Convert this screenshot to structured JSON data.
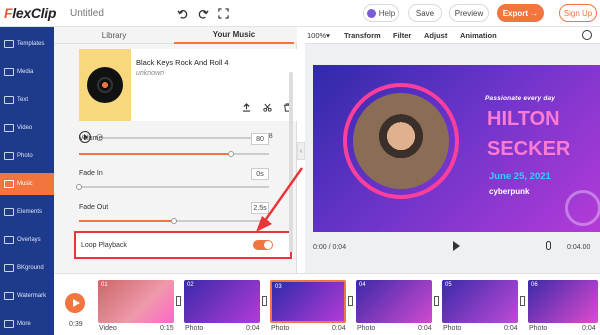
{
  "app": {
    "brand_first": "F",
    "brand_rest": "lexClip",
    "title_placeholder": "Untitled"
  },
  "topbar": {
    "help_label": "Help",
    "save_label": "Save",
    "preview_label": "Preview",
    "export_label": "Export →",
    "signup_label": "Sign Up"
  },
  "sidebar": {
    "items": [
      {
        "label": "Templates"
      },
      {
        "label": "Media"
      },
      {
        "label": "Text"
      },
      {
        "label": "Video"
      },
      {
        "label": "Photo"
      },
      {
        "label": "Music"
      },
      {
        "label": "Elements"
      },
      {
        "label": "Overlays"
      },
      {
        "label": "BKground"
      },
      {
        "label": "Watermark"
      },
      {
        "label": "More"
      }
    ],
    "active": "Music"
  },
  "panel": {
    "tabs": [
      {
        "label": "Library"
      },
      {
        "label": "Your Music"
      }
    ],
    "active_tab": "Your Music",
    "track": {
      "name": "Black Keys Rock And Roll 4",
      "artist": "unknown",
      "duration": "2:58"
    },
    "volume": {
      "label": "Volume",
      "value": "80",
      "level": 0.8
    },
    "fade_in": {
      "label": "Fade In",
      "value": "0s",
      "level": 0.0
    },
    "fade_out": {
      "label": "Fade Out",
      "value": "2.5s",
      "level": 0.5
    },
    "loop": {
      "label": "Loop Playback",
      "on": true
    }
  },
  "canvas_toolbar": {
    "zoom": "100%▾",
    "items": [
      "Transform",
      "Filter",
      "Adjust",
      "Animation"
    ]
  },
  "stage": {
    "tagline": "Passionate every day",
    "name_line1": "HILTON",
    "name_line2": "SECKER",
    "date": "June 25, 2021",
    "tag": "cyberpunk"
  },
  "player": {
    "current": "0:00 / 0:04",
    "total": "0:04.00"
  },
  "timeline": {
    "current_time": "0:39",
    "clips": [
      {
        "num": "01",
        "type": "Video",
        "time": "0:15"
      },
      {
        "num": "02",
        "type": "Photo",
        "time": "0:04"
      },
      {
        "num": "03",
        "type": "Photo",
        "time": "0:04"
      },
      {
        "num": "04",
        "type": "Photo",
        "time": "0:04"
      },
      {
        "num": "05",
        "type": "Photo",
        "time": "0:04"
      },
      {
        "num": "06",
        "type": "Photo",
        "time": "0:04"
      }
    ]
  },
  "colors": {
    "accent": "#f2743f",
    "sidebar": "#1e3a8a",
    "highlight": "#e8353a"
  }
}
